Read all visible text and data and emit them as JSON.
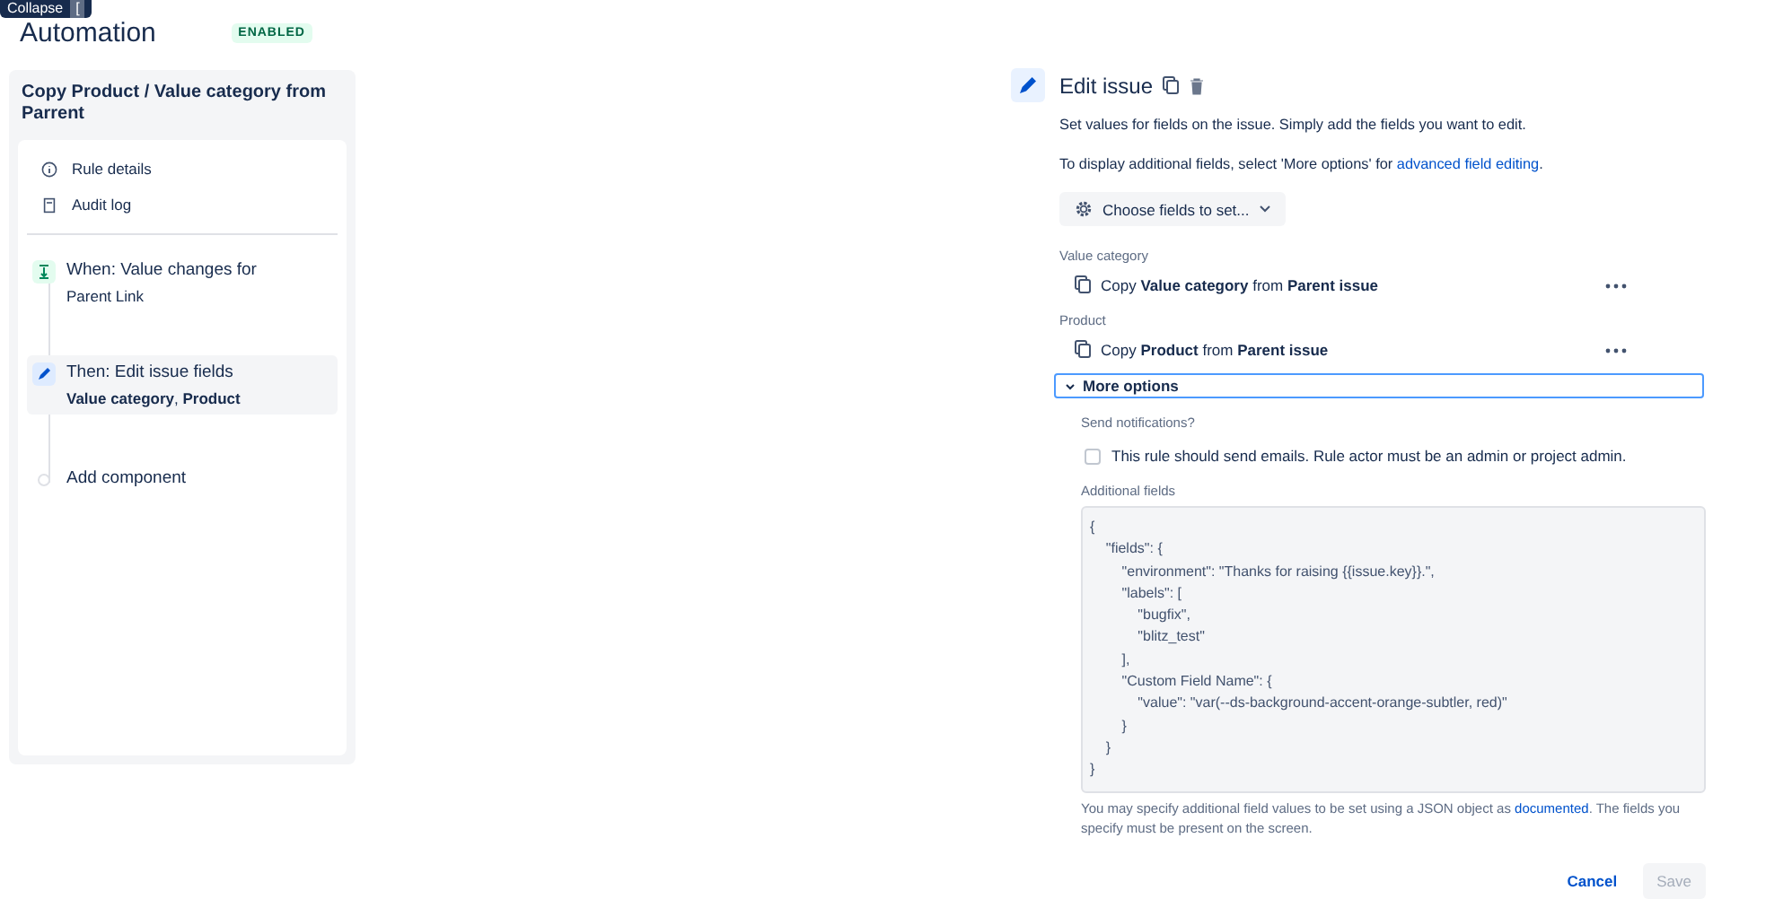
{
  "tooltip": {
    "label": "Collapse",
    "key": "["
  },
  "header": {
    "title": "Automation",
    "status": "ENABLED"
  },
  "rule": {
    "title": "Copy Product / Value category from Parrent",
    "menu": [
      {
        "kind": "info",
        "label": "Rule details"
      },
      {
        "kind": "log",
        "label": "Audit log"
      }
    ],
    "steps": [
      {
        "kind": "trigger",
        "title": "When: Value changes for",
        "detail": "Parent Link",
        "selected": false
      },
      {
        "kind": "action",
        "title": "Then: Edit issue fields",
        "detail": "**Value category**, **Product**",
        "selected": true
      },
      {
        "kind": "add",
        "title": "Add component",
        "selected": false
      }
    ]
  },
  "editor": {
    "title": "Edit issue",
    "description": "Set values for fields on the issue. Simply add the fields you want to edit.",
    "hint": {
      "before": "To display additional fields, select 'More options' for ",
      "link": "advanced field editing",
      "after": "."
    },
    "choose_button": "Choose fields to set...",
    "fields": [
      {
        "label": "Value category",
        "value": "Copy **Value category** from **Parent issue**"
      },
      {
        "label": "Product",
        "value": "Copy **Product** from **Parent issue**"
      }
    ],
    "more_options": {
      "label": "More options",
      "expanded": true,
      "notifications_label": "Send notifications?",
      "notify": {
        "label": "This rule should send emails. Rule actor must be an admin or project admin.",
        "checked": false
      },
      "additional_label": "Additional fields",
      "code": "{\n    \"fields\": {\n        \"environment\": \"Thanks for raising {{issue.key}}.\",\n        \"labels\": [\n            \"bugfix\",\n            \"blitz_test\"\n        ],\n        \"Custom Field Name\": {\n            \"value\": \"var(--ds-background-accent-orange-subtler, red)\"\n        }\n    }\n}",
      "help": {
        "before": "You may specify additional field values to be set using a JSON object as ",
        "link": "documented",
        "after": ". The fields you specify must be present on the screen."
      }
    },
    "buttons": {
      "cancel": "Cancel",
      "save": "Save",
      "save_disabled": true
    }
  }
}
